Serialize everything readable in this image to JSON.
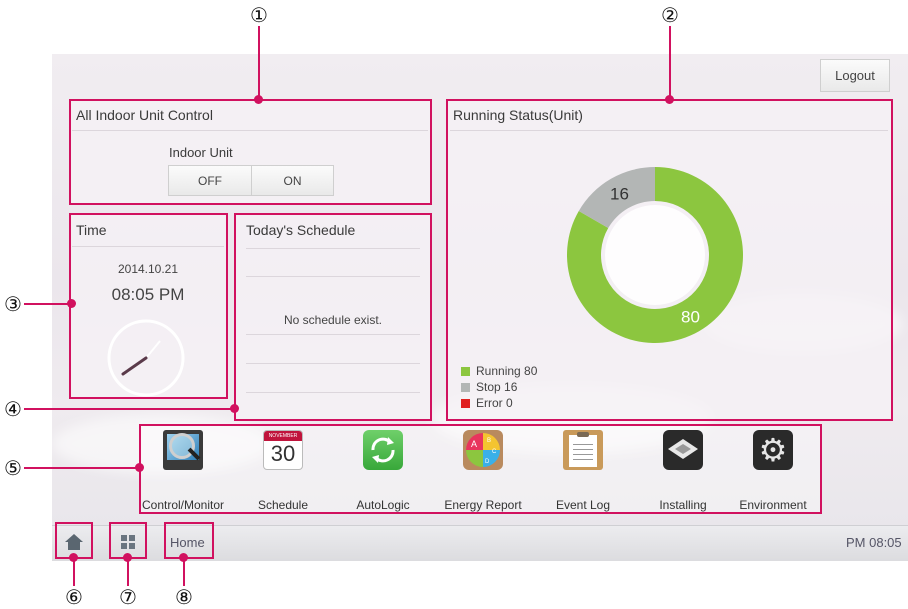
{
  "callouts": [
    "①",
    "②",
    "③",
    "④",
    "⑤",
    "⑥",
    "⑦",
    "⑧"
  ],
  "header": {
    "logout_label": "Logout"
  },
  "indoor_control": {
    "title": "All Indoor Unit Control",
    "subtitle": "Indoor Unit",
    "off_label": "OFF",
    "on_label": "ON"
  },
  "time": {
    "title": "Time",
    "date": "2014.10.21",
    "clock": "08:05 PM"
  },
  "schedule": {
    "title": "Today's Schedule",
    "empty_message": "No schedule exist."
  },
  "running_status": {
    "title": "Running Status(Unit)",
    "colors": {
      "running": "#8cc63f",
      "stop": "#b3b6b5",
      "error": "#e02020"
    },
    "legend": [
      "Running 80",
      "Stop 16",
      "Error 0"
    ]
  },
  "chart_data": {
    "type": "pie",
    "categories": [
      "Running",
      "Stop",
      "Error"
    ],
    "values": [
      80,
      16,
      0
    ],
    "data_labels": [
      "80",
      "16"
    ]
  },
  "apps": [
    {
      "label": "Control/Monitor",
      "icon": "monitor-magnifier-icon"
    },
    {
      "label": "Schedule",
      "icon": "calendar-icon",
      "calendar_month": "NOVEMBER",
      "calendar_day": "30"
    },
    {
      "label": "AutoLogic",
      "icon": "refresh-arrows-icon"
    },
    {
      "label": "Energy Report",
      "icon": "energy-pie-icon",
      "segments": [
        "A",
        "B",
        "C",
        "D"
      ]
    },
    {
      "label": "Event Log",
      "icon": "clipboard-icon"
    },
    {
      "label": "Installing",
      "icon": "ceiling-cassette-icon"
    },
    {
      "label": "Environment",
      "icon": "gear-icon"
    }
  ],
  "bottom_bar": {
    "breadcrumb": "Home",
    "clock": "PM 08:05"
  }
}
